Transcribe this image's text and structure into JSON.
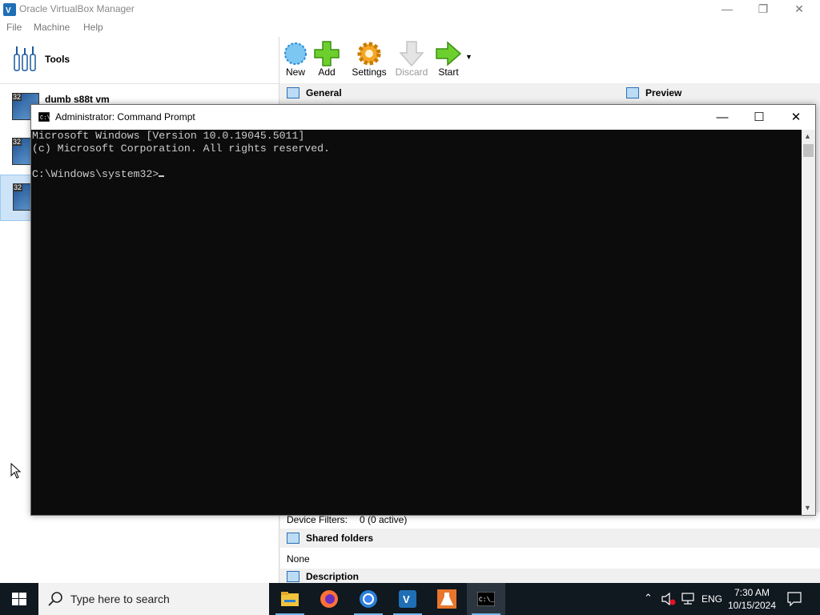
{
  "virtualbox": {
    "title": "Oracle VirtualBox Manager",
    "menu": [
      "File",
      "Machine",
      "Help"
    ],
    "tools_label": "Tools",
    "vms": [
      {
        "name": "dumb s88t vm",
        "badge": "32"
      },
      {
        "name": "",
        "badge": "32"
      },
      {
        "name": "",
        "badge": "32",
        "selected": true
      }
    ],
    "toolbar": {
      "new": "New",
      "add": "Add",
      "settings": "Settings",
      "discard": "Discard",
      "start": "Start"
    },
    "sections": {
      "general": "General",
      "preview": "Preview",
      "shared_folders": "Shared folders",
      "description": "Description"
    },
    "usb": {
      "label": "Device Filters:",
      "value": "0 (0 active)"
    },
    "shared_folders_value": "None"
  },
  "cmd": {
    "title": "Administrator: Command Prompt",
    "lines": [
      "Microsoft Windows [Version 10.0.19045.5011]",
      "(c) Microsoft Corporation. All rights reserved.",
      "",
      "C:\\Windows\\system32>"
    ]
  },
  "taskbar": {
    "search_placeholder": "Type here to search",
    "language": "ENG",
    "time": "7:30 AM",
    "date": "10/15/2024",
    "apps": [
      "file-explorer",
      "firefox",
      "chrome",
      "virtualbox",
      "lab-app",
      "command-prompt"
    ]
  }
}
